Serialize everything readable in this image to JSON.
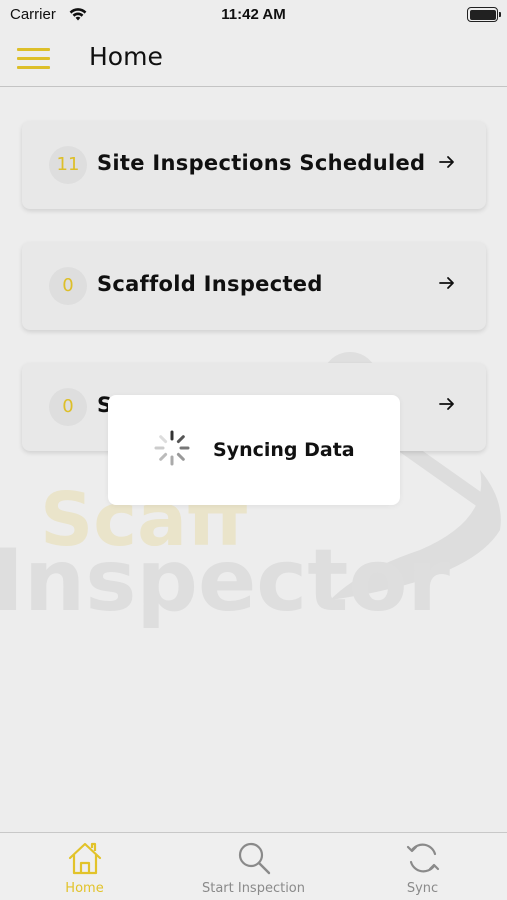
{
  "status_bar": {
    "carrier": "Carrier",
    "time": "11:42 AM"
  },
  "header": {
    "title": "Home",
    "menu_icon": "hamburger-menu-icon"
  },
  "cards": [
    {
      "count": "11",
      "label": "Site Inspections Scheduled",
      "icon": "arrow-right-icon"
    },
    {
      "count": "0",
      "label": "Scaffold Inspected",
      "icon": "arrow-right-icon"
    },
    {
      "count": "0",
      "label": "S",
      "icon": "arrow-right-icon"
    }
  ],
  "modal": {
    "text": "Syncing Data",
    "icon": "spinner-icon"
  },
  "watermark": {
    "line1": "Scaff",
    "line2": "Inspector"
  },
  "tabbar": {
    "tabs": [
      {
        "label": "Home",
        "icon": "home-icon",
        "active": true
      },
      {
        "label": "Start Inspection",
        "icon": "search-icon",
        "active": false
      },
      {
        "label": "Sync",
        "icon": "sync-icon",
        "active": false
      }
    ]
  },
  "colors": {
    "accent": "#e2c32a",
    "background": "#f2f2f2",
    "inactive": "#8a8a8a"
  }
}
